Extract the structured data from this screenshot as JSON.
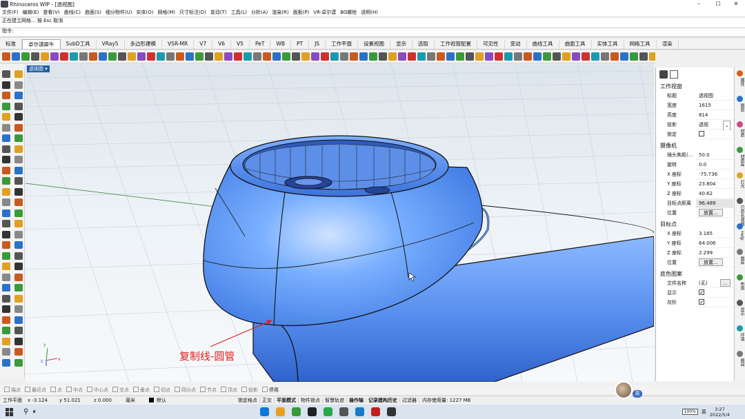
{
  "window": {
    "title": "Rhinoceros WIP - [透视图]",
    "btn_min": "–",
    "btn_max": "☐",
    "btn_close": "✕"
  },
  "menu": [
    "文件(F)",
    "编辑(E)",
    "查看(V)",
    "曲线(C)",
    "曲面(S)",
    "细分物件(U)",
    "实体(O)",
    "网格(M)",
    "尺寸标注(D)",
    "变动(T)",
    "工具(L)",
    "分析(A)",
    "渲染(R)",
    "面板(P)",
    "VR-卓尔谟",
    "BG螺栓",
    "说明(H)"
  ],
  "command": {
    "history": [
      "正在建立网格... 按 Esc 取消"
    ],
    "prompt": "指令:"
  },
  "tabs": [
    "标准",
    "卓尔谟犀牛",
    "SubD工具",
    "VRay5",
    "多边形建模",
    "VSR-MR",
    "V7",
    "V6",
    "V5",
    "PeT",
    "WB",
    "PT",
    "JS",
    "工作平面",
    "设置视图",
    "显示",
    "选取",
    "工作视窗配置",
    "可见性",
    "变动",
    "曲线工具",
    "曲面工具",
    "实体工具",
    "网格工具",
    "渲染"
  ],
  "active_tab": 1,
  "viewport": {
    "label": "透视图 ▾",
    "annotation": "复制线-圆管",
    "axis_x": "x",
    "axis_y": "y",
    "axis_z": "z"
  },
  "panel": {
    "section_view": "工作视窗",
    "view_rows": [
      {
        "k": "标题",
        "v": "透视图"
      },
      {
        "k": "宽度",
        "v": "1615"
      },
      {
        "k": "高度",
        "v": "814"
      },
      {
        "k": "投影",
        "v": "透视"
      },
      {
        "k": "锁定",
        "v": ""
      }
    ],
    "section_camera": "摄像机",
    "camera_rows": [
      {
        "k": "镜头焦距(...",
        "v": "50.0"
      },
      {
        "k": "旋转",
        "v": "0.0"
      },
      {
        "k": "X 座标",
        "v": "-75.736"
      },
      {
        "k": "Y 座标",
        "v": "23.804"
      },
      {
        "k": "Z 座标",
        "v": "40.62"
      },
      {
        "k": "目标点距离",
        "v": "96.489"
      },
      {
        "k": "位置",
        "v": "放置..."
      }
    ],
    "section_target": "目标点",
    "target_rows": [
      {
        "k": "X 座标",
        "v": "3.165"
      },
      {
        "k": "Y 座标",
        "v": "64.006"
      },
      {
        "k": "Z 座标",
        "v": "2.299"
      },
      {
        "k": "位置",
        "v": "放置..."
      }
    ],
    "section_bg": "底色图案",
    "bg_rows": [
      {
        "k": "文件名称",
        "v": "(无)"
      },
      {
        "k": "显示",
        "v": ""
      },
      {
        "k": "灰阶",
        "v": ""
      }
    ],
    "more_btn": "..."
  },
  "side_tabs": [
    "属性",
    "图层",
    "材质",
    "材质库",
    "灯光",
    "已命名视图",
    "Help",
    "图库",
    "布局",
    "显示",
    "环境",
    "图间"
  ],
  "snaps": [
    "端点",
    "最近点",
    "点",
    "中点",
    "中心点",
    "交点",
    "垂点",
    "切点",
    "四分点",
    "节点",
    "顶点",
    "投影",
    "停用"
  ],
  "status": {
    "plane": "工作平面",
    "x": "x -3.124",
    "y": "y 51.021",
    "z": "z 0.000",
    "unit": "毫米",
    "layer": "默认",
    "toggles": [
      "锁定格点",
      "正交",
      "平面模式",
      "物件锁点",
      "智慧轨迹",
      "操作轴",
      "记录建构历史",
      "过滤器"
    ],
    "memory": "内存使用量: 1227 MB"
  },
  "avatar_label": "英",
  "taskbar": {
    "search": "⚲",
    "battery": "100%",
    "lang": "英",
    "time": "3:27",
    "date": "2022/5/4"
  }
}
